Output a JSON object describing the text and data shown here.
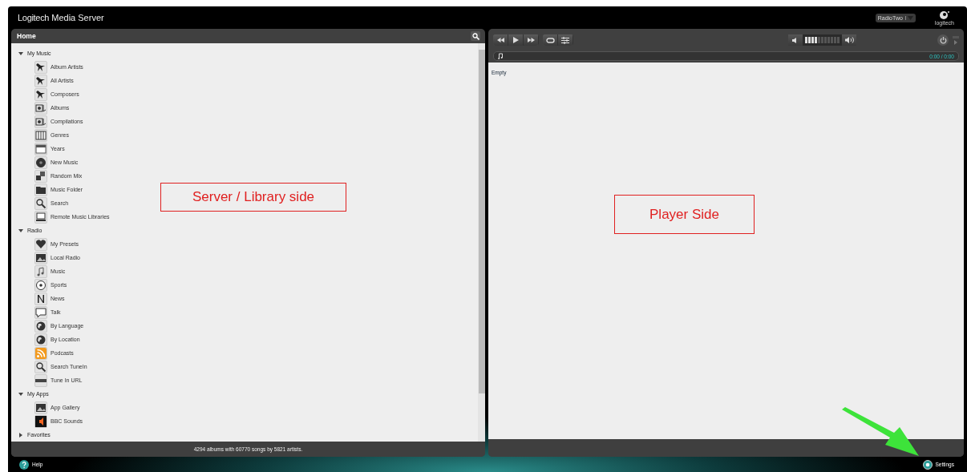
{
  "window": {
    "title_brand": "Logitech",
    "title_rest": "Media Server",
    "player_select": "RadioTwo",
    "logo_text": "logitech"
  },
  "library": {
    "title": "Home",
    "groups": [
      {
        "label": "My Music",
        "expanded": true,
        "items": [
          "Album Artists",
          "All Artists",
          "Composers",
          "Albums",
          "Compilations",
          "Genres",
          "Years",
          "New Music",
          "Random Mix",
          "Music Folder",
          "Search",
          "Remote Music Libraries"
        ]
      },
      {
        "label": "Radio",
        "expanded": true,
        "items": [
          "My Presets",
          "Local Radio",
          "Music",
          "Sports",
          "News",
          "Talk",
          "By Language",
          "By Location",
          "Podcasts",
          "Search TuneIn",
          "Tune In URL"
        ]
      },
      {
        "label": "My Apps",
        "expanded": true,
        "items": [
          "App Gallery",
          "BBC Sounds"
        ]
      },
      {
        "label": "Favorites",
        "expanded": false
      }
    ],
    "status": "4294 albums with 60770 songs by 5821 artists."
  },
  "player": {
    "volume": {
      "level": 0.36
    },
    "progress": {
      "level": 0
    },
    "time": "0:00 / 0:00",
    "playlist_text": "Empty"
  },
  "footer": {
    "help": "Help",
    "settings": "Settings"
  },
  "annotations": [
    {
      "kind": "box",
      "text": "Server / Library side"
    },
    {
      "kind": "box",
      "text": "Player Side"
    },
    {
      "kind": "arrow"
    }
  ]
}
